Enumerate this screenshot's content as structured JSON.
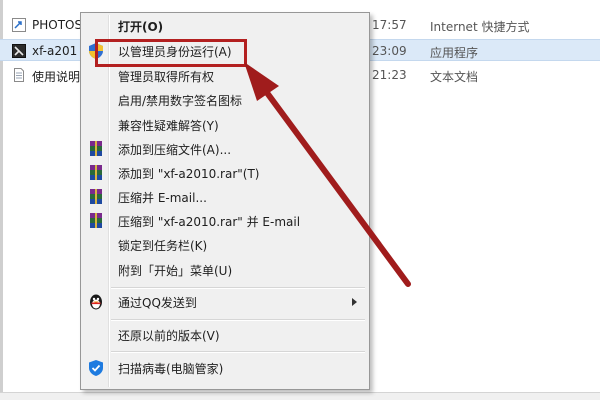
{
  "files": [
    {
      "name": "PHOTOS",
      "time": "17:57",
      "type": "Internet 快捷方式",
      "icon": "shortcut-icon"
    },
    {
      "name": "xf-a201",
      "time": "23:09",
      "type": "应用程序",
      "icon": "application-icon"
    },
    {
      "name": "使用说明",
      "time": "21:23",
      "type": "文本文档",
      "icon": "text-document-icon"
    }
  ],
  "context_menu": {
    "open": "打开(O)",
    "run_as_admin": "以管理员身份运行(A)",
    "take_ownership": "管理员取得所有权",
    "toggle_signature": "启用/禁用数字签名图标",
    "compat_troubleshoot": "兼容性疑难解答(Y)",
    "add_to_archive": "添加到压缩文件(A)...",
    "add_to_rar": "添加到 \"xf-a2010.rar\"(T)",
    "compress_email": "压缩并 E-mail...",
    "compress_rar_email": "压缩到 \"xf-a2010.rar\" 并 E-mail",
    "pin_taskbar": "锁定到任务栏(K)",
    "pin_start": "附到「开始」菜单(U)",
    "send_qq": "通过QQ发送到",
    "restore_previous": "还原以前的版本(V)",
    "scan_virus": "扫描病毒(电脑管家)"
  },
  "colors": {
    "highlight_border": "#b32020",
    "arrow": "#a01c1c",
    "selected_row": "#dbe9f8",
    "menu_bg": "#f0f0f0"
  }
}
